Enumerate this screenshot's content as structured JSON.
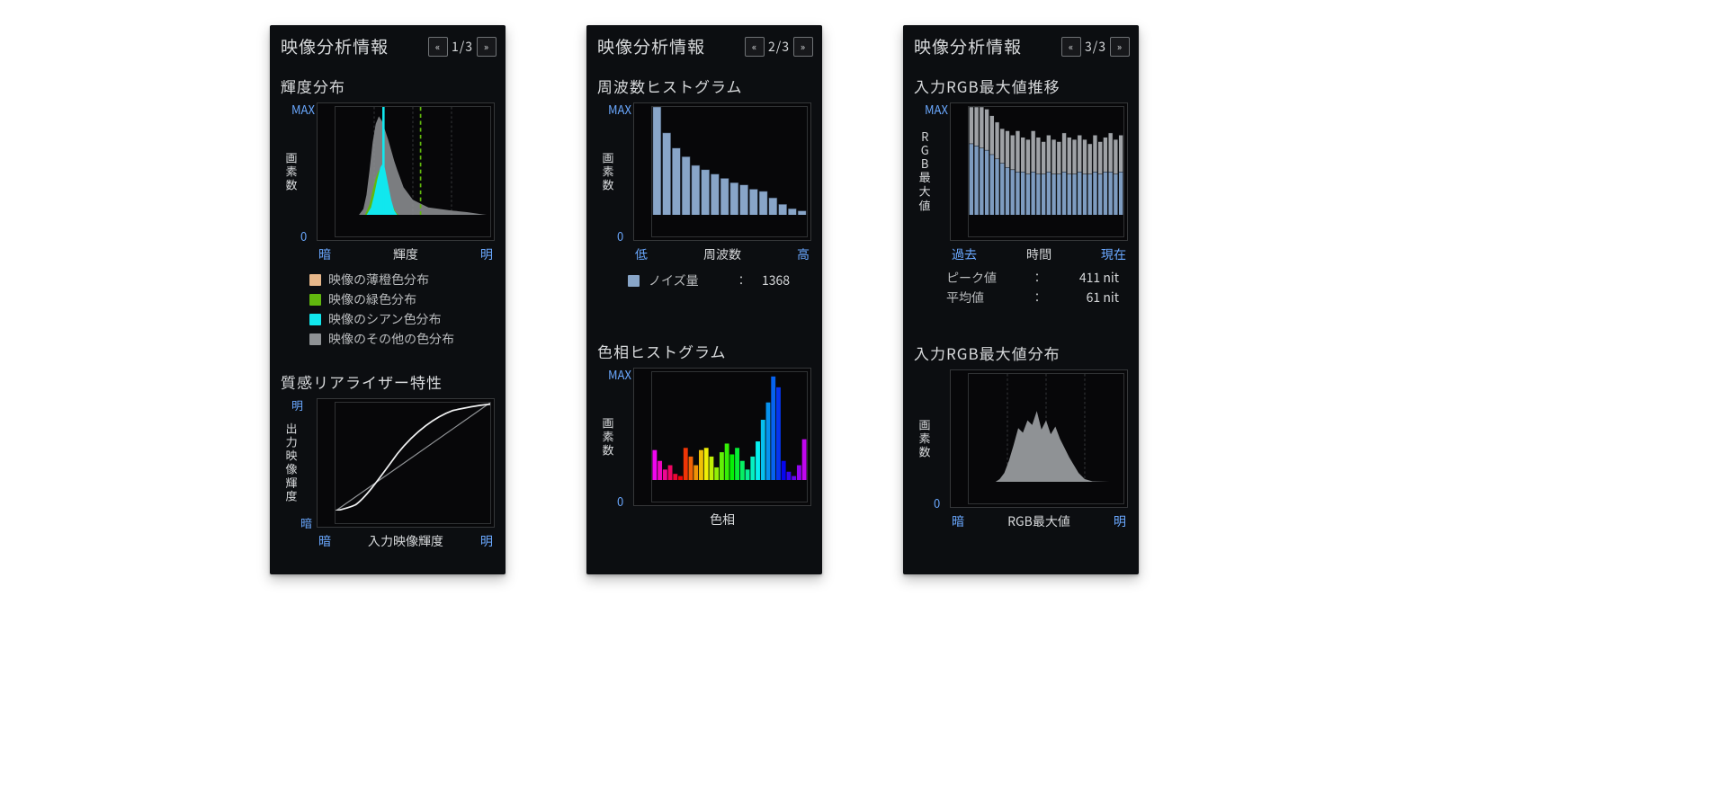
{
  "colors": {
    "blue": "#6aa8ff",
    "cyan": "#11e7ee",
    "green": "#61b70e",
    "orange": "#e7b78a",
    "grey": "#8f9295",
    "barblue": "#88a5c8",
    "line": "#cfd1d3"
  },
  "panels": [
    {
      "title": "映像分析情報",
      "page": "1/3",
      "sections": {
        "luminance": {
          "title": "輝度分布",
          "ylab": "画素数",
          "ymax": "MAX",
          "yzero": "0",
          "xleft": "暗",
          "xmid": "輝度",
          "xright": "明",
          "legend": [
            {
              "color": "#e7b78a",
              "label": "映像の薄橙色分布"
            },
            {
              "color": "#61b70e",
              "label": "映像の緑色分布"
            },
            {
              "color": "#11e7ee",
              "label": "映像のシアン色分布"
            },
            {
              "color": "#8f9295",
              "label": "映像のその他の色分布"
            }
          ]
        },
        "tone": {
          "title": "質感リアライザー特性",
          "yleft_top": "明",
          "yleft_bot": "暗",
          "ylab": "出力映像輝度",
          "xleft": "暗",
          "xmid": "入力映像輝度",
          "xright": "明"
        }
      }
    },
    {
      "title": "映像分析情報",
      "page": "2/3",
      "sections": {
        "freq": {
          "title": "周波数ヒストグラム",
          "ylab": "画素数",
          "ymax": "MAX",
          "yzero": "0",
          "xleft": "低",
          "xmid": "周波数",
          "xright": "高",
          "noise": {
            "swatch": "#88a5c8",
            "label": "ノイズ量",
            "value": "1368"
          }
        },
        "hue": {
          "title": "色相ヒストグラム",
          "ylab": "画素数",
          "ymax": "MAX",
          "yzero": "0",
          "xmid": "色相"
        }
      }
    },
    {
      "title": "映像分析情報",
      "page": "3/3",
      "sections": {
        "rgbTime": {
          "title": "入力RGB最大値推移",
          "ylab": "RGB最大値",
          "ymax": "MAX",
          "xleft": "過去",
          "xmid": "時間",
          "xright": "現在",
          "legend": [
            {
              "color": "#b9bbbe",
              "label": "ピーク値",
              "value": "411 nit"
            },
            {
              "color": "#88a5c8",
              "label": "平均値",
              "value": "61 nit"
            }
          ]
        },
        "rgbDist": {
          "title": "入力RGB最大値分布",
          "ylab": "画素数",
          "yzero": "0",
          "xleft": "暗",
          "xmid": "RGB最大値",
          "xright": "明"
        }
      }
    }
  ],
  "chart_data": [
    {
      "id": "luminance_distribution",
      "type": "area",
      "title": "輝度分布",
      "xlabel": "輝度",
      "ylabel": "画素数",
      "xlim": [
        0,
        100
      ],
      "ylim": [
        0,
        100
      ],
      "x": [
        0,
        5,
        10,
        15,
        18,
        20,
        22,
        24,
        26,
        28,
        30,
        32,
        34,
        36,
        38,
        40,
        45,
        50,
        55,
        60,
        65,
        70,
        75,
        80,
        85,
        90,
        95,
        100
      ],
      "series": [
        {
          "name": "映像のその他の色分布",
          "color": "#8f9295",
          "values": [
            0,
            0,
            0,
            6,
            18,
            42,
            66,
            84,
            92,
            86,
            78,
            70,
            58,
            48,
            40,
            34,
            24,
            16,
            12,
            10,
            6,
            4,
            4,
            2,
            2,
            1,
            1,
            0
          ]
        },
        {
          "name": "映像の緑色分布",
          "color": "#61b70e",
          "values": [
            0,
            0,
            0,
            0,
            4,
            12,
            24,
            36,
            42,
            40,
            34,
            26,
            18,
            12,
            8,
            4,
            2,
            0,
            0,
            0,
            0,
            0,
            0,
            0,
            0,
            0,
            0,
            0
          ]
        },
        {
          "name": "映像のシアン色分布",
          "color": "#11e7ee",
          "values": [
            0,
            0,
            0,
            0,
            2,
            8,
            20,
            34,
            46,
            50,
            44,
            30,
            18,
            8,
            2,
            0,
            0,
            0,
            0,
            0,
            0,
            0,
            0,
            0,
            0,
            0,
            0,
            0
          ]
        }
      ],
      "markers": [
        {
          "kind": "vline",
          "x": 31,
          "color": "#11e7ee"
        },
        {
          "kind": "vline-dashed",
          "x": 55,
          "color": "#61b70e"
        }
      ]
    },
    {
      "id": "tone_curve",
      "type": "line",
      "title": "質感リアライザー特性",
      "xlabel": "入力映像輝度",
      "ylabel": "出力映像輝度",
      "xlim": [
        0,
        100
      ],
      "ylim": [
        0,
        100
      ],
      "series": [
        {
          "name": "identity",
          "color": "#8f9295",
          "x": [
            0,
            100
          ],
          "y": [
            0,
            100
          ]
        },
        {
          "name": "curve",
          "color": "#f1f2f3",
          "x": [
            0,
            6,
            12,
            18,
            25,
            32,
            40,
            50,
            60,
            70,
            78,
            86,
            92,
            96,
            100
          ],
          "y": [
            0,
            2,
            5,
            10,
            22,
            36,
            52,
            68,
            80,
            88,
            93,
            96,
            98,
            99,
            100
          ]
        }
      ]
    },
    {
      "id": "frequency_histogram",
      "type": "bar",
      "title": "周波数ヒストグラム",
      "xlabel": "周波数",
      "ylabel": "画素数",
      "categories": [
        "1",
        "2",
        "3",
        "4",
        "5",
        "6",
        "7",
        "8",
        "9",
        "10",
        "11",
        "12",
        "13",
        "14",
        "15",
        "16"
      ],
      "values": [
        100,
        76,
        62,
        54,
        46,
        42,
        38,
        34,
        30,
        28,
        24,
        22,
        16,
        10,
        6,
        4
      ],
      "ylim": [
        0,
        100
      ],
      "annotations": {
        "ノイズ量": 1368
      }
    },
    {
      "id": "hue_histogram",
      "type": "bar",
      "title": "色相ヒストグラム",
      "xlabel": "色相",
      "ylabel": "画素数",
      "categories": [
        "0",
        "12",
        "24",
        "36",
        "48",
        "60",
        "72",
        "84",
        "96",
        "108",
        "120",
        "132",
        "144",
        "156",
        "168",
        "180",
        "192",
        "204",
        "216",
        "228",
        "240",
        "252",
        "264",
        "276",
        "288",
        "300",
        "312",
        "324",
        "336",
        "348"
      ],
      "values": [
        28,
        18,
        10,
        14,
        6,
        4,
        30,
        22,
        14,
        28,
        30,
        22,
        12,
        26,
        34,
        24,
        30,
        18,
        10,
        22,
        36,
        56,
        72,
        96,
        86,
        18,
        8,
        4,
        14,
        38
      ],
      "ylim": [
        0,
        100
      ],
      "note": "bar color = HSL hue of category"
    },
    {
      "id": "rgb_max_over_time",
      "type": "bar",
      "title": "入力RGB最大値推移",
      "xlabel": "時間",
      "ylabel": "RGB最大値",
      "categories": [
        "t1",
        "t2",
        "t3",
        "t4",
        "t5",
        "t6",
        "t7",
        "t8",
        "t9",
        "t10",
        "t11",
        "t12",
        "t13",
        "t14",
        "t15",
        "t16",
        "t17",
        "t18",
        "t19",
        "t20",
        "t21",
        "t22",
        "t23",
        "t24",
        "t25",
        "t26",
        "t27",
        "t28",
        "t29",
        "t30"
      ],
      "series": [
        {
          "name": "ピーク値",
          "color": "#b9bbbe",
          "values": [
            100,
            100,
            100,
            98,
            92,
            86,
            80,
            78,
            74,
            78,
            72,
            70,
            78,
            72,
            68,
            74,
            70,
            68,
            76,
            72,
            70,
            74,
            70,
            66,
            74,
            68,
            72,
            76,
            70,
            74
          ]
        },
        {
          "name": "平均値",
          "color": "#88a5c8",
          "values": [
            66,
            64,
            62,
            60,
            56,
            52,
            48,
            44,
            42,
            40,
            40,
            38,
            40,
            38,
            38,
            40,
            38,
            38,
            40,
            38,
            38,
            40,
            38,
            38,
            40,
            38,
            40,
            40,
            38,
            40
          ]
        }
      ],
      "legend_values": {
        "ピーク値": "411 nit",
        "平均値": "61 nit"
      },
      "ylim": [
        0,
        100
      ]
    },
    {
      "id": "rgb_max_distribution",
      "type": "area",
      "title": "入力RGB最大値分布",
      "xlabel": "RGB最大値",
      "ylabel": "画素数",
      "xlim": [
        0,
        100
      ],
      "ylim": [
        0,
        100
      ],
      "x": [
        0,
        6,
        12,
        18,
        22,
        26,
        30,
        34,
        38,
        42,
        46,
        50,
        54,
        58,
        62,
        66,
        70,
        74,
        78,
        82,
        86,
        90,
        94,
        100
      ],
      "series": [
        {
          "name": "分布",
          "color": "#8f9295",
          "values": [
            0,
            0,
            0,
            2,
            6,
            14,
            26,
            40,
            54,
            48,
            60,
            56,
            68,
            52,
            58,
            46,
            42,
            30,
            22,
            14,
            8,
            4,
            0,
            0
          ]
        }
      ]
    }
  ]
}
